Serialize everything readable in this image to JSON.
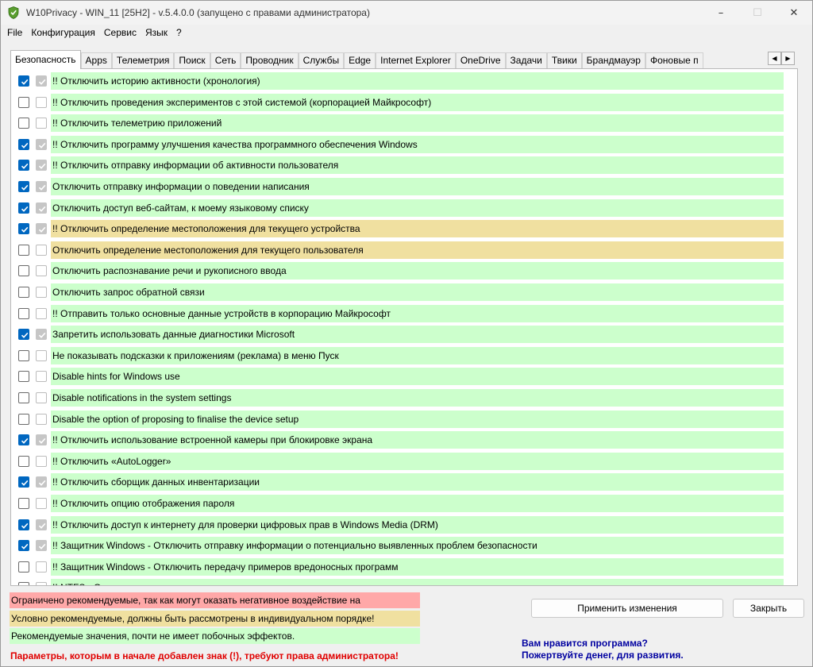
{
  "window": {
    "title": "W10Privacy - WIN_11 [25H2]  - v.5.4.0.0 (запущено с правами администратора)",
    "controls": [
      "–",
      "☐",
      "✕"
    ]
  },
  "menu": [
    "File",
    "Конфигурация",
    "Сервис",
    "Язык",
    "?"
  ],
  "tabs": [
    "Безопасность",
    "Apps",
    "Телеметрия",
    "Поиск",
    "Сеть",
    "Проводник",
    "Службы",
    "Edge",
    "Internet Explorer",
    "OneDrive",
    "Задачи",
    "Твики",
    "Брандмауэр",
    "Фоновые п"
  ],
  "active_tab": "Безопасность",
  "colors": {
    "green": "#ccffcc",
    "yellow": "#f0e0a0",
    "red": "#ffa8a8",
    "accent": "#0067c0"
  },
  "settings": [
    {
      "label": "!! Отключить историю активности (хронология)",
      "c1": true,
      "c2": true,
      "color": "green"
    },
    {
      "label": "!! Отключить проведения экспериментов с этой системой (корпорацией Майкрософт)",
      "c1": false,
      "c2": false,
      "color": "green"
    },
    {
      "label": "!! Отключить телеметрию приложений",
      "c1": false,
      "c2": false,
      "color": "green"
    },
    {
      "label": "!! Отключить программу улучшения качества программного обеспечения Windows",
      "c1": true,
      "c2": true,
      "color": "green"
    },
    {
      "label": "!! Отключить отправку информации об активности пользователя",
      "c1": true,
      "c2": true,
      "color": "green"
    },
    {
      "label": "Отключить отправку информации о поведении написания",
      "c1": true,
      "c2": true,
      "color": "green"
    },
    {
      "label": "Отключить доступ веб-сайтам, к моему языковому списку",
      "c1": true,
      "c2": true,
      "color": "green"
    },
    {
      "label": "!! Отключить определение местоположения для текущего устройства",
      "c1": true,
      "c2": true,
      "color": "yellow"
    },
    {
      "label": "Отключить определение местоположения для текущего пользователя",
      "c1": false,
      "c2": false,
      "color": "yellow"
    },
    {
      "label": "Отключить распознавание речи и рукописного ввода",
      "c1": false,
      "c2": false,
      "color": "green"
    },
    {
      "label": "Отключить запрос обратной связи",
      "c1": false,
      "c2": false,
      "color": "green"
    },
    {
      "label": "!! Отправить только основные данные устройств в корпорацию Майкрософт",
      "c1": false,
      "c2": false,
      "color": "green"
    },
    {
      "label": "Запретить использовать данные диагностики Microsoft",
      "c1": true,
      "c2": true,
      "color": "green"
    },
    {
      "label": "Не показывать подсказки к приложениям (реклама) в меню Пуск",
      "c1": false,
      "c2": false,
      "color": "green"
    },
    {
      "label": "Disable hints for Windows use",
      "c1": false,
      "c2": false,
      "color": "green"
    },
    {
      "label": "Disable notifications in the system settings",
      "c1": false,
      "c2": false,
      "color": "green"
    },
    {
      "label": "Disable the option of proposing to finalise the device setup",
      "c1": false,
      "c2": false,
      "color": "green"
    },
    {
      "label": "!! Отключить использование встроенной камеры при блокировке экрана",
      "c1": true,
      "c2": true,
      "color": "green"
    },
    {
      "label": "!! Отключить «AutoLogger»",
      "c1": false,
      "c2": false,
      "color": "green"
    },
    {
      "label": "!! Отключить сборщик данных инвентаризации",
      "c1": true,
      "c2": true,
      "color": "green"
    },
    {
      "label": "!! Отключить опцию отображения пароля",
      "c1": false,
      "c2": false,
      "color": "green"
    },
    {
      "label": "!! Отключить доступ к интернету для проверки цифровых прав в Windows Media (DRM)",
      "c1": true,
      "c2": true,
      "color": "green"
    },
    {
      "label": "!! Защитник Windows - Отключить отправку информации о потенциально выявленных проблем безопасности",
      "c1": true,
      "c2": true,
      "color": "green"
    },
    {
      "label": "!! Защитник Windows - Отключить передачу примеров вредоносных программ",
      "c1": false,
      "c2": false,
      "color": "green"
    },
    {
      "label": "!! NTFS - О...",
      "c1": false,
      "c2": false,
      "color": "green"
    }
  ],
  "legend": [
    {
      "text": "Ограничено рекомендуемые, так как могут оказать негативное воздействие на",
      "color": "red"
    },
    {
      "text": "Условно рекомендуемые, должны быть рассмотрены в индивидуальном порядке!",
      "color": "yellow"
    },
    {
      "text": "Рекомендуемые значения, почти не имеет побочных эффектов.",
      "color": "green"
    }
  ],
  "admin_note": "Параметры, которым в начале добавлен знак (!), требуют права администратора!",
  "buttons": {
    "apply": "Применить изменения",
    "close": "Закрыть"
  },
  "donate": {
    "line1": "Вам нравится программа?",
    "line2": "Пожертвуйте денег, для развития."
  }
}
